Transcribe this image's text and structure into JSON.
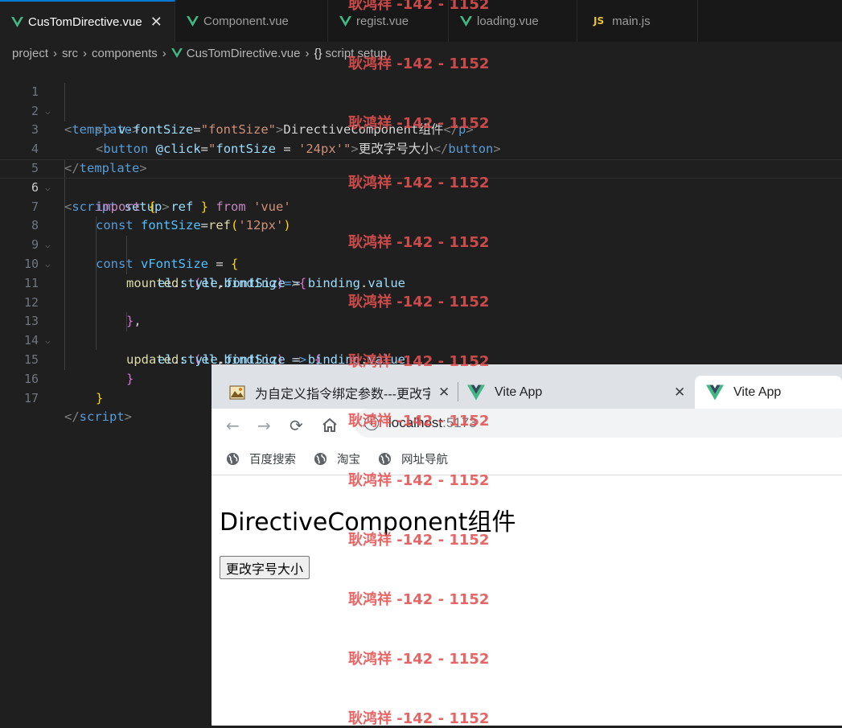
{
  "editor": {
    "tabs": [
      {
        "label": "CusTomDirective.vue",
        "icon": "vue-icon",
        "active": true,
        "close": "✕"
      },
      {
        "label": "Component.vue",
        "icon": "vue-icon"
      },
      {
        "label": "regist.vue",
        "icon": "vue-icon"
      },
      {
        "label": "loading.vue",
        "icon": "vue-icon"
      },
      {
        "label": "main.js",
        "icon": "js-icon",
        "icon_text": "JS"
      }
    ],
    "breadcrumb": {
      "items": [
        "project",
        "src",
        "components",
        "CusTomDirective.vue",
        "script setup"
      ],
      "braces": "{}"
    },
    "line_numbers": [
      "1",
      "2",
      "3",
      "4",
      "5",
      "6",
      "7",
      "8",
      "9",
      "10",
      "11",
      "12",
      "13",
      "14",
      "15",
      "16",
      "17"
    ],
    "current_line": "6"
  },
  "code": {
    "l1": {
      "a": "<",
      "b": "template",
      "c": ">"
    },
    "l2": {
      "a": "<",
      "b": "p",
      "c": " v-fontSize",
      "d": "=",
      "e": "\"fontSize\"",
      "f": ">",
      "g": "DirectiveComponent组件",
      "h": "</",
      "i": "p",
      "j": ">"
    },
    "l3": {
      "a": "<",
      "b": "button",
      "c": " @click",
      "d": "=",
      "e": "\"",
      "f": "fontSize",
      "g": " = ",
      "h": "'24px'",
      "i": "\"",
      "j": ">",
      "k": "更改字号大小",
      "l": "</",
      "m": "button",
      "n": ">"
    },
    "l4": {
      "a": "</",
      "b": "template",
      "c": ">"
    },
    "l5": {
      "a": "<",
      "b": "script",
      "c": " setup",
      "d": ">"
    },
    "l6": {
      "a": "import",
      "b": " {",
      "c": "  ref ",
      "d": "}",
      "e": " from ",
      "f": "'vue'"
    },
    "l7": {
      "a": "const",
      "b": " fontSize",
      "c": "=",
      "d": "ref",
      "e": "(",
      "f": "'12px'",
      "g": ")"
    },
    "l8": {
      "a": "const",
      "b": " vFontSize",
      "c": " = ",
      "d": "{"
    },
    "l9": {
      "a": "mounted",
      "b": ": ",
      "c": "(",
      "d": "el",
      "e": ",",
      "f": "binding",
      "g": ")",
      "h": "=>",
      "i": "{"
    },
    "l10": {
      "a": "el",
      "b": ".",
      "c": "style",
      "d": ".",
      "e": "fontSize",
      "f": " = ",
      "g": "binding",
      "h": ".",
      "i": "value"
    },
    "l12": {
      "a": "}",
      "b": ","
    },
    "l13": {
      "a": "updated",
      "b": ": ",
      "c": "(",
      "d": "el",
      "e": ",",
      "f": "binding",
      "g": ")",
      "h": " => ",
      "i": "{"
    },
    "l14": {
      "a": "el",
      "b": ".",
      "c": "style",
      "d": ".",
      "e": "fontSize",
      "f": " = ",
      "g": "binding",
      "h": ".",
      "i": "value"
    },
    "l15": {
      "a": "}"
    },
    "l16": {
      "a": "}"
    },
    "l17": {
      "a": "</",
      "b": "script",
      "c": ">"
    }
  },
  "browser": {
    "tabs": [
      {
        "title": "为自定义指令绑定参数---更改字",
        "icon": "article-favicon-icon",
        "close": "✕"
      },
      {
        "title": "Vite App",
        "icon": "vite-favicon-icon",
        "close": "✕"
      },
      {
        "title": "Vite App",
        "icon": "vite-favicon-icon",
        "active": true
      }
    ],
    "address": {
      "host": "localhost",
      "port": ":5173"
    },
    "bookmarks": [
      "百度搜索",
      "淘宝",
      "网址导航"
    ],
    "page": {
      "heading": "DirectiveComponent组件",
      "button_label": "更改字号大小"
    }
  },
  "watermark": {
    "text": "耿鸿祥 -142 - 1152",
    "color": "#e35050"
  },
  "colors": {
    "editor_bg": "#1f1f1f",
    "accent": "#0078d4",
    "vue_green": "#41b883"
  }
}
